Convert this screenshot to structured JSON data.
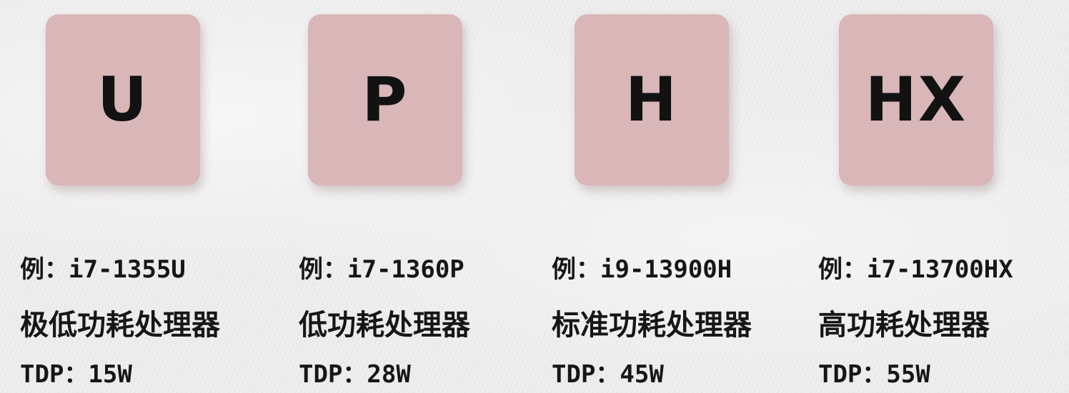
{
  "cards": [
    {
      "letter": "U",
      "example": "例：i7-1355U",
      "description": "极低功耗处理器",
      "tdp": "TDP：15W"
    },
    {
      "letter": "P",
      "example": "例：i7-1360P",
      "description": "低功耗处理器",
      "tdp": "TDP：28W"
    },
    {
      "letter": "H",
      "example": "例：i9-13900H",
      "description": "标准功耗处理器",
      "tdp": "TDP：45W"
    },
    {
      "letter": "HX",
      "example": "例：i7-13700HX",
      "description": "高功耗处理器",
      "tdp": "TDP：55W"
    }
  ],
  "colors": {
    "tile": "#d9b6b8",
    "text": "#161616",
    "background": "#efeeee"
  }
}
